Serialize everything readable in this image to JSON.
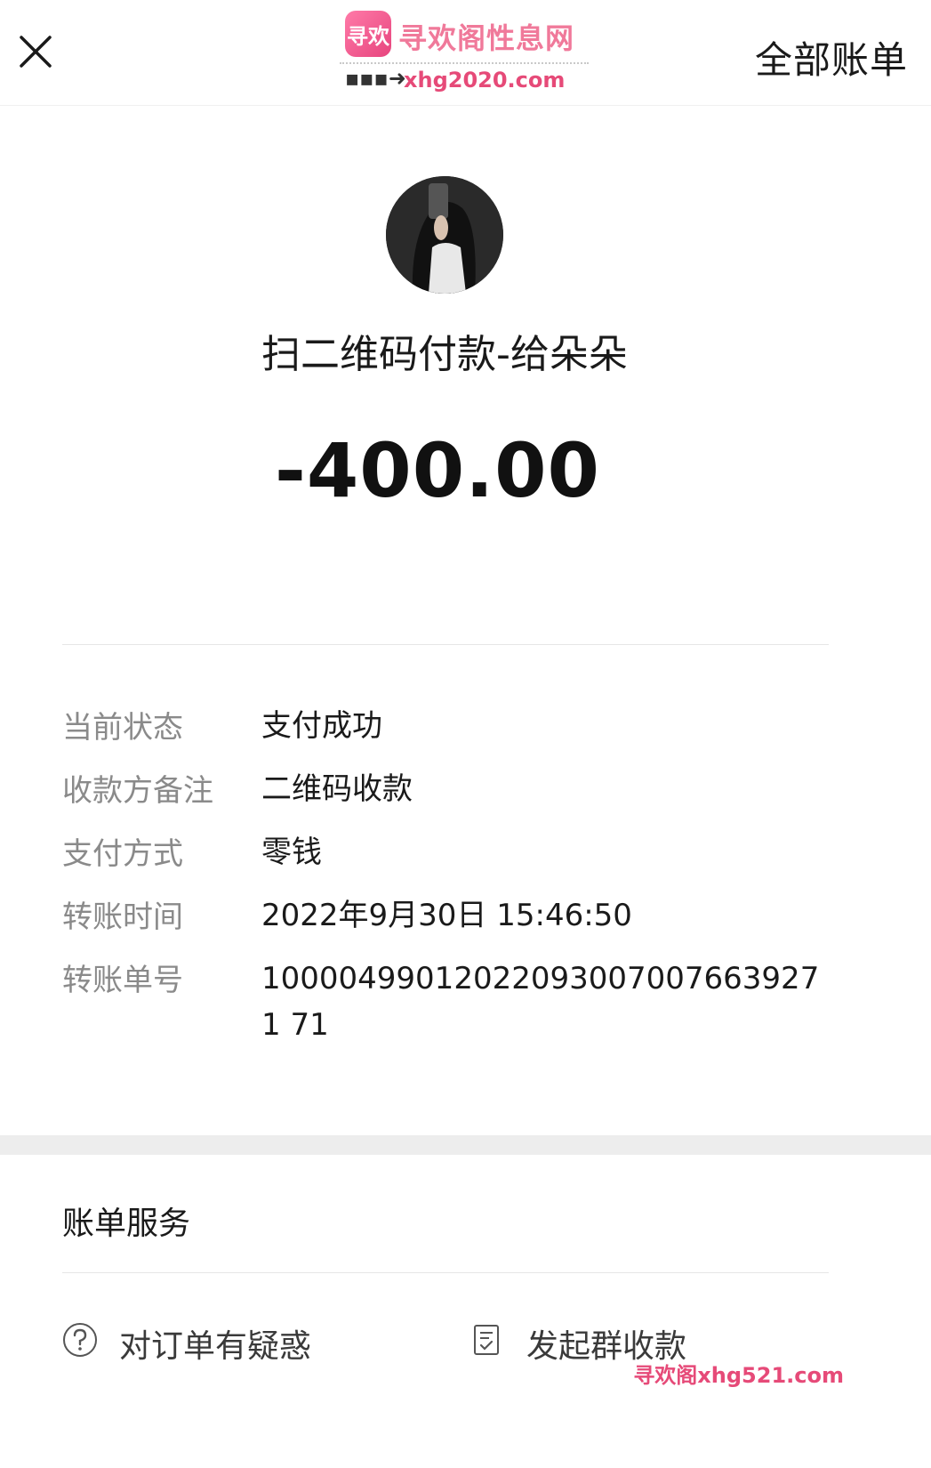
{
  "header": {
    "all_bills_label": "全部账单"
  },
  "watermark": {
    "logo_text": "寻欢",
    "site_name": "寻欢阁性息网",
    "site_url": "xhg2020.com",
    "bottom_text": "寻欢阁xhg521.com",
    "color": "#e64a78"
  },
  "payment": {
    "title": "扫二维码付款-给朵朵",
    "amount": "-400.00"
  },
  "details": [
    {
      "label": "当前状态",
      "value": "支付成功"
    },
    {
      "label": "收款方备注",
      "value": "二维码收款"
    },
    {
      "label": "支付方式",
      "value": "零钱"
    },
    {
      "label": "转账时间",
      "value": "2022年9月30日 15:46:50"
    },
    {
      "label": "转账单号",
      "value": "100004990120220930070076639271 71"
    }
  ],
  "services": {
    "title": "账单服务",
    "items": [
      {
        "label": "对订单有疑惑",
        "icon": "question-circle-icon"
      },
      {
        "label": "发起群收款",
        "icon": "document-check-icon"
      }
    ]
  }
}
